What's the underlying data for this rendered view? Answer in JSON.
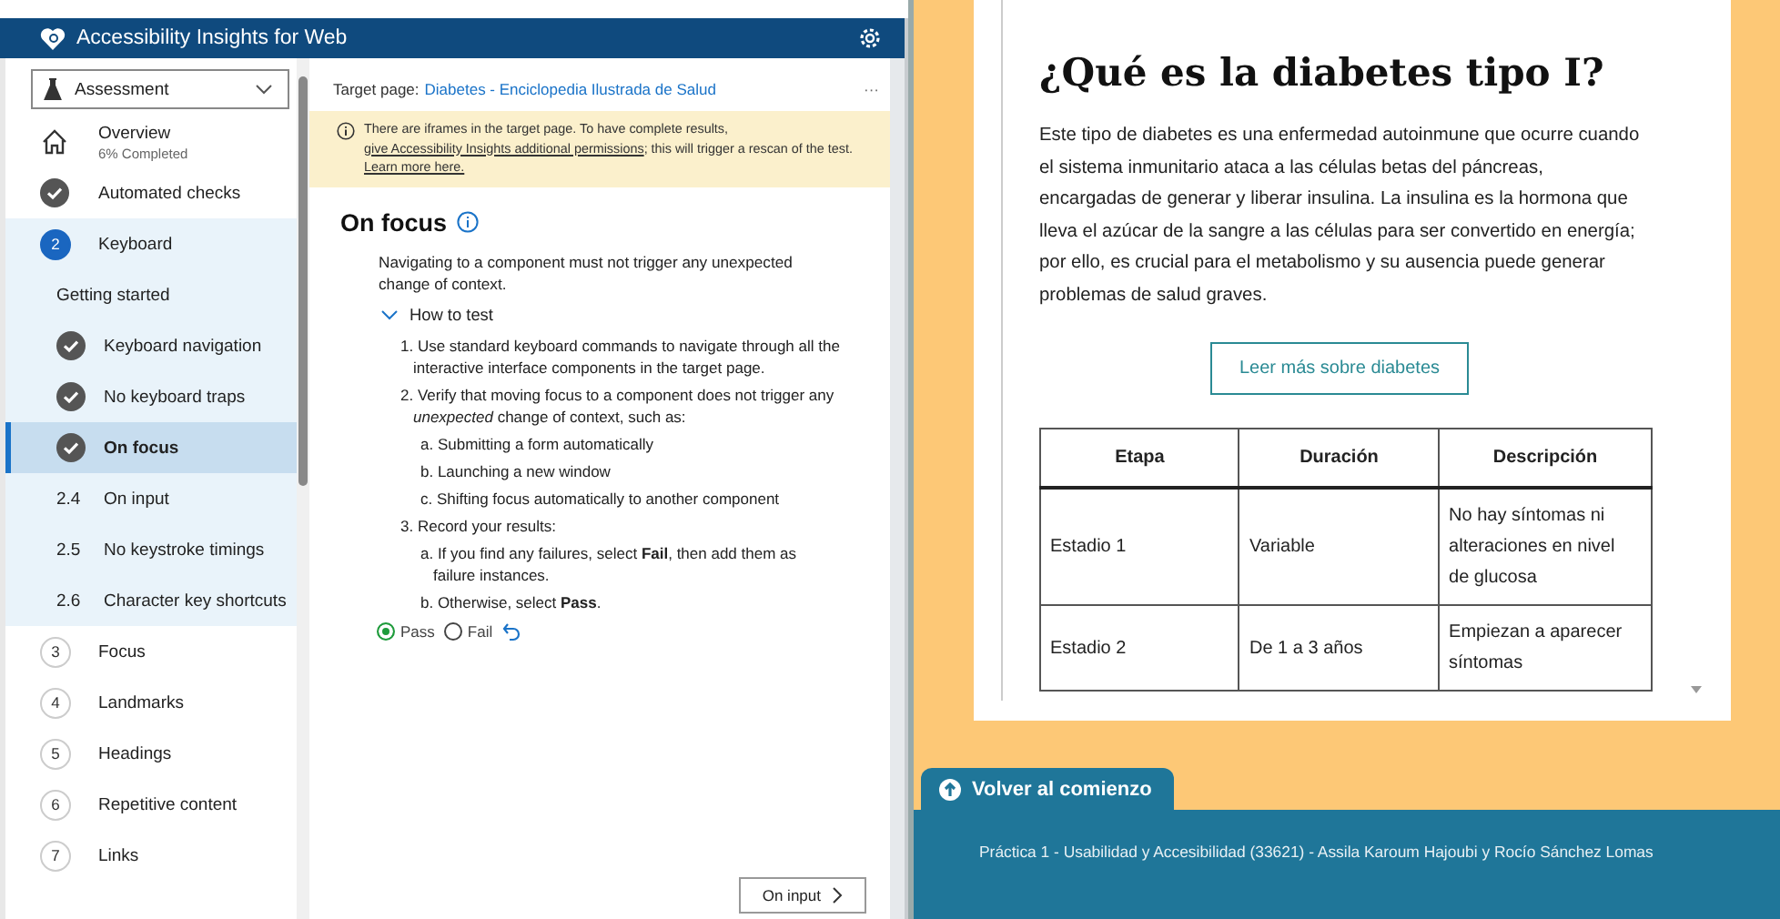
{
  "window": {
    "title": "Accessibility Insights for Web"
  },
  "sidebar": {
    "dropdown": {
      "value": "Assessment"
    },
    "items": [
      {
        "kind": "overview",
        "label": "Overview",
        "sublabel": "6% Completed",
        "selected": false,
        "expanded": false
      },
      {
        "kind": "done",
        "label": "Automated checks",
        "selected": false,
        "expanded": false
      },
      {
        "kind": "number",
        "number": "2",
        "label": "Keyboard",
        "selected": false,
        "expanded": true,
        "children": [
          {
            "kind": "plain",
            "label": "Getting started",
            "selected": false
          },
          {
            "kind": "done",
            "label": "Keyboard navigation",
            "selected": false
          },
          {
            "kind": "done",
            "label": "No keyboard traps",
            "selected": false
          },
          {
            "kind": "done",
            "label": "On focus",
            "selected": true
          },
          {
            "kind": "number",
            "number": "2.4",
            "label": "On input",
            "selected": false
          },
          {
            "kind": "number",
            "number": "2.5",
            "label": "No keystroke timings",
            "selected": false
          },
          {
            "kind": "number",
            "number": "2.6",
            "label": "Character key shortcuts",
            "selected": false
          }
        ]
      },
      {
        "kind": "number",
        "number": "3",
        "label": "Focus",
        "selected": false,
        "expanded": false
      },
      {
        "kind": "number",
        "number": "4",
        "label": "Landmarks",
        "selected": false,
        "expanded": false
      },
      {
        "kind": "number",
        "number": "5",
        "label": "Headings",
        "selected": false,
        "expanded": false
      },
      {
        "kind": "number",
        "number": "6",
        "label": "Repetitive content",
        "selected": false,
        "expanded": false
      },
      {
        "kind": "number",
        "number": "7",
        "label": "Links",
        "selected": false,
        "expanded": false
      }
    ]
  },
  "main": {
    "target_label": "Target page:",
    "target_link": "Diabetes - Enciclopedia Ilustrada de Salud",
    "more": "···",
    "banner": {
      "text": "There are iframes in the target page. To have complete results,",
      "link": "give Accessibility Insights additional permissions",
      "after": "; this will trigger a rescan of the test.",
      "link2": "Learn more here."
    },
    "heading": "On focus",
    "description": "Navigating to a component must not trigger any unexpected change of context.",
    "how_to_test": {
      "label": "How to test",
      "expanded": true,
      "steps": [
        {
          "text": "1. Use standard keyboard commands to navigate through all the interactive interface components in the target page."
        },
        {
          "text": "2. Verify that moving focus to a component does not trigger any *unexpected* change of context, such as:",
          "children": [
            "a. Submitting a form automatically",
            "b. Launching a new window",
            "c. Shifting focus automatically to another component"
          ]
        },
        {
          "text": "3. Record your results:",
          "children": [
            "a. If you find any failures, select **Fail**, then add them as failure instances.",
            "b. Otherwise, select **Pass**."
          ]
        }
      ]
    },
    "results": [
      {
        "label": "Pass",
        "selected": true
      },
      {
        "label": "Fail",
        "selected": false
      }
    ],
    "next_button": "On input"
  },
  "page": {
    "heading": "¿Qué es la diabetes tipo I?",
    "paragraph": "Este tipo de diabetes es una enfermedad autoinmune que ocurre cuando el sistema inmunitario ataca a las células betas del páncreas, encargadas de generar y liberar insulina. La insulina es la hormona que lleva el azúcar de la sangre a las células para ser convertido en energía; por ello, es crucial para el metabolismo y su ausencia puede generar problemas de salud graves.",
    "button": "Leer más sobre diabetes",
    "table": {
      "columns": [
        "Etapa",
        "Duración",
        "Descripción"
      ],
      "rows": [
        [
          "Estadio 1",
          "Variable",
          "No hay síntomas ni alteraciones en nivel de glucosa"
        ],
        [
          "Estadio 2",
          "De 1 a 3 años",
          "Empiezan a aparecer síntomas"
        ]
      ]
    },
    "back_to_top": "Volver al comienzo",
    "footer": "Práctica 1 - Usabilidad y Accesibilidad (33621) - Assila Karoum Hajoubi y Rocío Sánchez Lomas"
  }
}
